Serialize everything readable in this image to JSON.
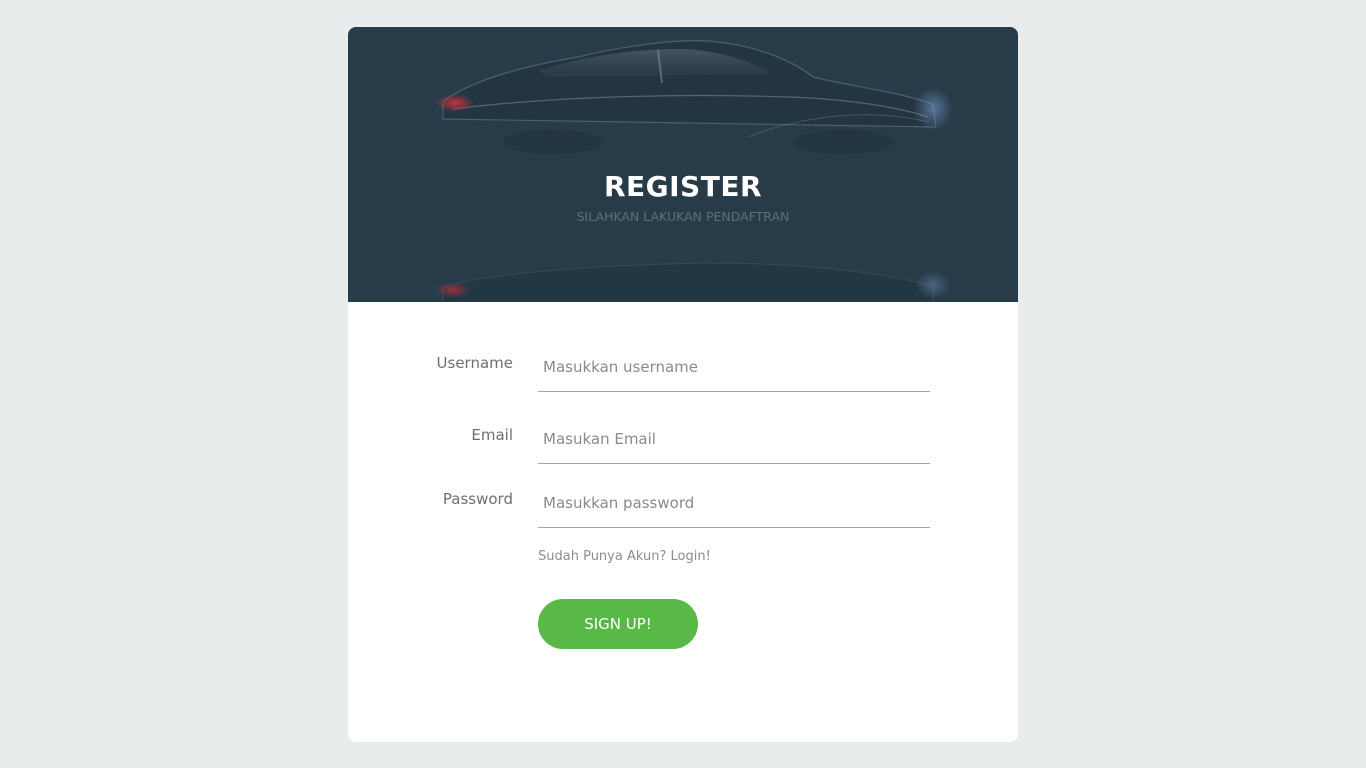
{
  "header": {
    "title": "REGISTER",
    "subtitle": "SILAHKAN LAKUKAN PENDAFTRAN",
    "background_color": "#283b49"
  },
  "form": {
    "username": {
      "label": "Username",
      "placeholder": "Masukkan username",
      "value": ""
    },
    "email": {
      "label": "Email",
      "placeholder": "Masukan Email",
      "value": ""
    },
    "password": {
      "label": "Password",
      "placeholder": "Masukkan password",
      "value": ""
    },
    "login_link": "Sudah Punya Akun? Login!",
    "submit_label": "SIGN UP!",
    "submit_color": "#58b946"
  }
}
